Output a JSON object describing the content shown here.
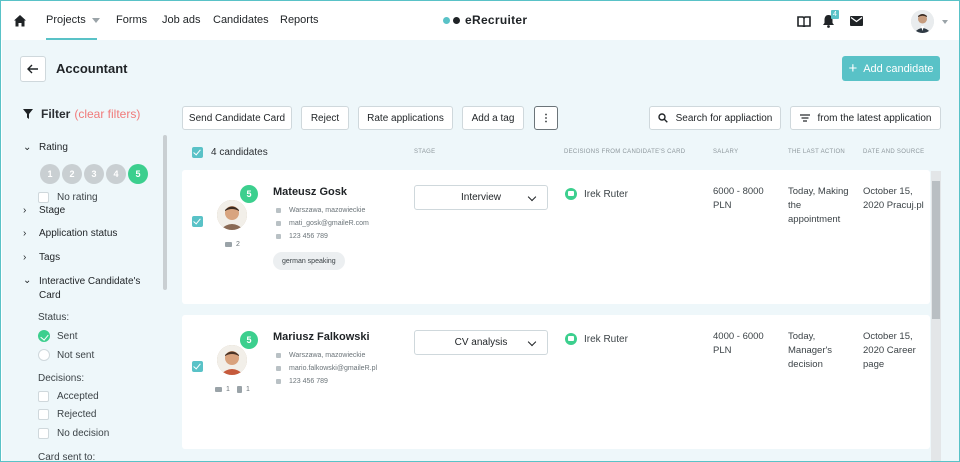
{
  "nav": {
    "items": [
      "Projects",
      "Forms",
      "Job ads",
      "Candidates",
      "Reports"
    ],
    "brand": "eRecruiter",
    "notification_count": "4"
  },
  "header": {
    "title": "Accountant",
    "add_candidate": "Add candidate"
  },
  "filter": {
    "title": "Filter",
    "clear": "(clear filters)",
    "rating_label": "Rating",
    "ratings": [
      "1",
      "2",
      "3",
      "4",
      "5"
    ],
    "no_rating": "No rating",
    "stage": "Stage",
    "application_status": "Application status",
    "tags": "Tags",
    "interactive_card": "Interactive Candidate's Card",
    "status_label": "Status:",
    "sent": "Sent",
    "not_sent": "Not sent",
    "decisions_label": "Decisions:",
    "accepted": "Accepted",
    "rejected": "Rejected",
    "no_decision": "No decision",
    "card_sent_to": "Card sent to:"
  },
  "toolbar": {
    "send_card": "Send Candidate Card",
    "reject": "Reject",
    "rate": "Rate applications",
    "add_tag": "Add a tag",
    "more": "⋮",
    "search": "Search for appliaction",
    "sort": "from the latest application"
  },
  "table": {
    "count": "4 candidates",
    "headers": {
      "stage": "STAGE",
      "decisions": "DECISIONS FROM CANDIDATE'S CARD",
      "salary": "SALARY",
      "last_action": "THE LAST ACTION",
      "date_source": "DATE AND SOURCE"
    }
  },
  "candidates": [
    {
      "score": "5",
      "name": "Mateusz Gosk",
      "location": "Warszawa, mazowieckie",
      "email": "mati_gosk@gmaileR.com",
      "phone": "123 456 789",
      "tag": "german speaking",
      "messages": "2",
      "stage": "Interview",
      "decision_by": "Irek Ruter",
      "salary": "6000 - 8000 PLN",
      "last_action": "Today, Making the appointment",
      "date_source": "October 15, 2020 Pracuj.pl"
    },
    {
      "score": "5",
      "name": "Mariusz Falkowski",
      "location": "Warszawa, mazowieckie",
      "email": "mario.falkowski@gmaileR.pl",
      "phone": "123 456 789",
      "messages": "1",
      "documents": "1",
      "stage": "CV analysis",
      "decision_by": "Irek Ruter",
      "salary": "4000 - 6000 PLN",
      "last_action": "Today, Manager's decision",
      "date_source": "October 15, 2020 Career page"
    }
  ],
  "colors": {
    "accent": "#59c2c7",
    "success": "#3ccf8e",
    "danger": "#f07a7a",
    "background": "#eef7fa"
  }
}
